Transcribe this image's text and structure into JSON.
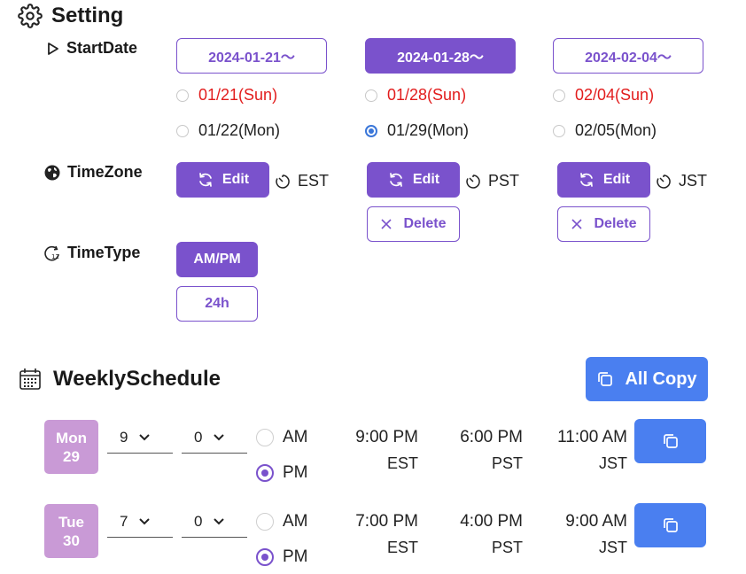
{
  "setting": {
    "title": "Setting"
  },
  "start_date": {
    "label": "StartDate",
    "weeks": [
      {
        "button": "2024-01-21～",
        "selected": false,
        "days": [
          {
            "text": "01/21(Sun)",
            "checked": false,
            "sunday": true
          },
          {
            "text": "01/22(Mon)",
            "checked": false,
            "sunday": false
          }
        ]
      },
      {
        "button": "2024-01-28～",
        "selected": true,
        "days": [
          {
            "text": "01/28(Sun)",
            "checked": false,
            "sunday": true
          },
          {
            "text": "01/29(Mon)",
            "checked": true,
            "sunday": false
          }
        ]
      },
      {
        "button": "2024-02-04～",
        "selected": false,
        "days": [
          {
            "text": "02/04(Sun)",
            "checked": false,
            "sunday": true
          },
          {
            "text": "02/05(Mon)",
            "checked": false,
            "sunday": false
          }
        ]
      }
    ]
  },
  "timezone": {
    "label": "TimeZone",
    "edit_label": "Edit",
    "delete_label": "Delete",
    "zones": [
      "EST",
      "PST",
      "JST"
    ]
  },
  "timetype": {
    "label": "TimeType",
    "options": [
      "AM/PM",
      "24h"
    ],
    "selected": "AM/PM"
  },
  "weekly": {
    "title": "WeeklySchedule",
    "all_copy_label": "All Copy",
    "am_label": "AM",
    "pm_label": "PM",
    "rows": [
      {
        "day": "Mon",
        "date": "29",
        "hour": "9",
        "minute": "0",
        "period": "PM",
        "conversions": [
          {
            "time": "9:00 PM",
            "zone": "EST"
          },
          {
            "time": "6:00 PM",
            "zone": "PST"
          },
          {
            "time": "11:00 AM",
            "zone": "JST"
          }
        ]
      },
      {
        "day": "Tue",
        "date": "30",
        "hour": "7",
        "minute": "0",
        "period": "PM",
        "conversions": [
          {
            "time": "7:00 PM",
            "zone": "EST"
          },
          {
            "time": "4:00 PM",
            "zone": "PST"
          },
          {
            "time": "9:00 AM",
            "zone": "JST"
          }
        ]
      }
    ]
  },
  "colors": {
    "accent": "#7a52cc",
    "blue": "#4a7ff0",
    "day_badge": "#c99ad6",
    "sunday": "#e21c1c"
  }
}
